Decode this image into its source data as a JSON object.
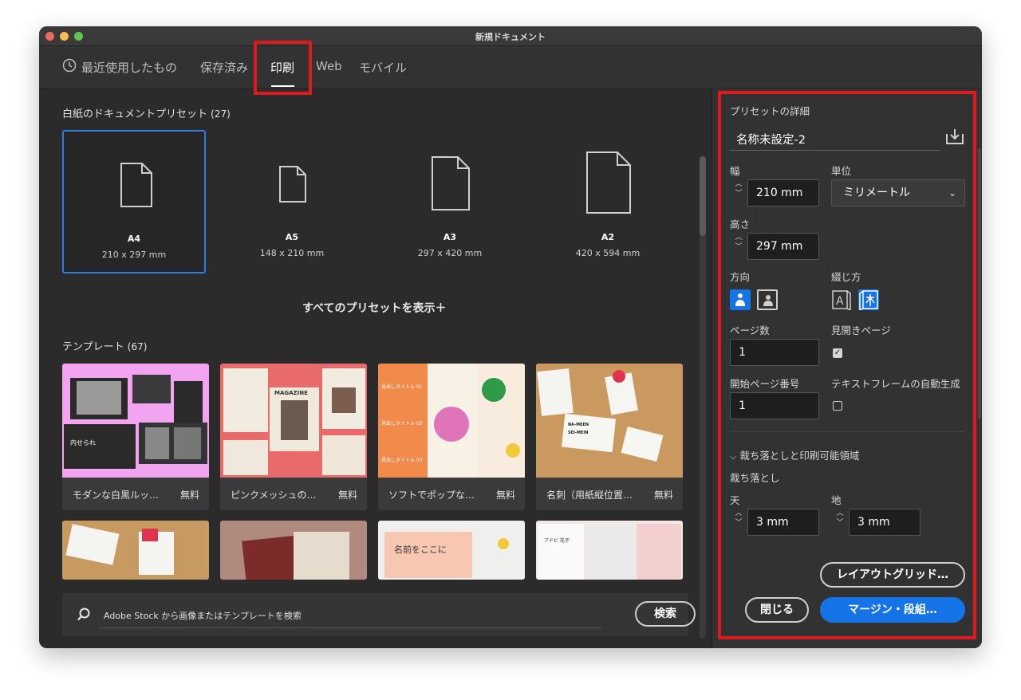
{
  "window": {
    "title": "新規ドキュメント"
  },
  "tabs": [
    {
      "label": "最近使用したもの",
      "icon": "clock-icon"
    },
    {
      "label": "保存済み"
    },
    {
      "label": "印刷",
      "active": true
    },
    {
      "label": "Web"
    },
    {
      "label": "モバイル"
    }
  ],
  "presets": {
    "heading": "白紙のドキュメントプリセット",
    "count": "(27)",
    "items": [
      {
        "name": "A4",
        "dims": "210 x 297 mm",
        "selected": true
      },
      {
        "name": "A5",
        "dims": "148 x 210 mm"
      },
      {
        "name": "A3",
        "dims": "297 x 420 mm"
      },
      {
        "name": "A2",
        "dims": "420 x 594 mm"
      }
    ],
    "show_all": "すべてのプリセットを表示＋"
  },
  "templates": {
    "heading": "テンプレート",
    "count": "(67)",
    "items": [
      {
        "label": "モダンな白黒ルッ…",
        "price": "無料"
      },
      {
        "label": "ピンクメッシュの…",
        "price": "無料"
      },
      {
        "label": "ソフトでポップな…",
        "price": "無料"
      },
      {
        "label": "名刺（用紙縦位置…",
        "price": "無料"
      }
    ],
    "thumb_text": {
      "t1": "内せられ",
      "t2": "MAGAZINE",
      "t3a": "見出しタイトル 01",
      "t3b": "見出しタイトル 02",
      "t3c": "見出しタイトル 03",
      "t4a": "NA-MEEN",
      "t4b": "SEI-MEIN",
      "r2c": "名前をここに",
      "r2d": "アドビ 花子"
    }
  },
  "search": {
    "placeholder": "Adobe Stock から画像またはテンプレートを検索",
    "button": "検索"
  },
  "details": {
    "heading": "プリセットの詳細",
    "doc_name": "名称未設定-2",
    "width_label": "幅",
    "width_value": "210 mm",
    "unit_label": "単位",
    "unit_value": "ミリメートル",
    "height_label": "高さ",
    "height_value": "297 mm",
    "orientation_label": "方向",
    "binding_label": "綴じ方",
    "pages_label": "ページ数",
    "pages_value": "1",
    "facing_label": "見開きページ",
    "facing_checked": true,
    "start_label": "開始ページ番号",
    "start_value": "1",
    "textframe_label": "テキストフレームの自動生成",
    "textframe_checked": false,
    "bleed_section": "裁ち落としと印刷可能領域",
    "bleed_label": "裁ち落とし",
    "top_label": "天",
    "top_value": "3 mm",
    "bottom_label": "地",
    "bottom_value": "3 mm",
    "layout_grid_btn": "レイアウトグリッド…",
    "close_btn": "閉じる",
    "margin_btn": "マージン・段組…"
  }
}
